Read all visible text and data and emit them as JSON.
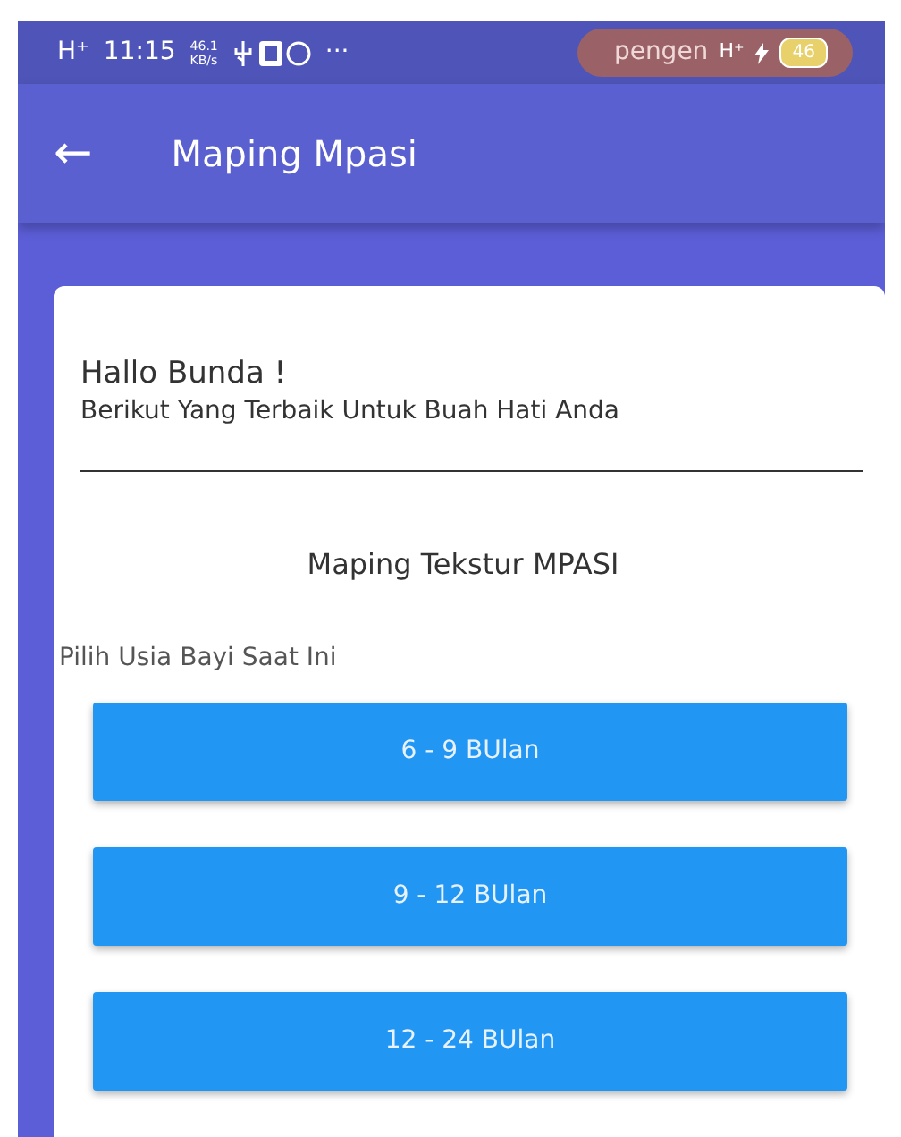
{
  "status_bar": {
    "network": "H⁺",
    "time": "11:15",
    "speed": "46.1",
    "speed_unit": "KB/s",
    "more": "···",
    "pill": "pengen",
    "network_right": "H⁺",
    "battery": "46"
  },
  "app_bar": {
    "back": "←",
    "title": "Maping Mpasi"
  },
  "card": {
    "greeting": "Hallo Bunda !",
    "subtitle": "Berikut Yang Terbaik Untuk Buah Hati Anda",
    "heading": "Maping Tekstur MPASI",
    "prompt": "Pilih Usia Bayi Saat Ini",
    "options": [
      {
        "label": "6 - 9 BUlan"
      },
      {
        "label": "9 - 12 BUlan"
      },
      {
        "label": "12 - 24 BUlan"
      }
    ]
  }
}
